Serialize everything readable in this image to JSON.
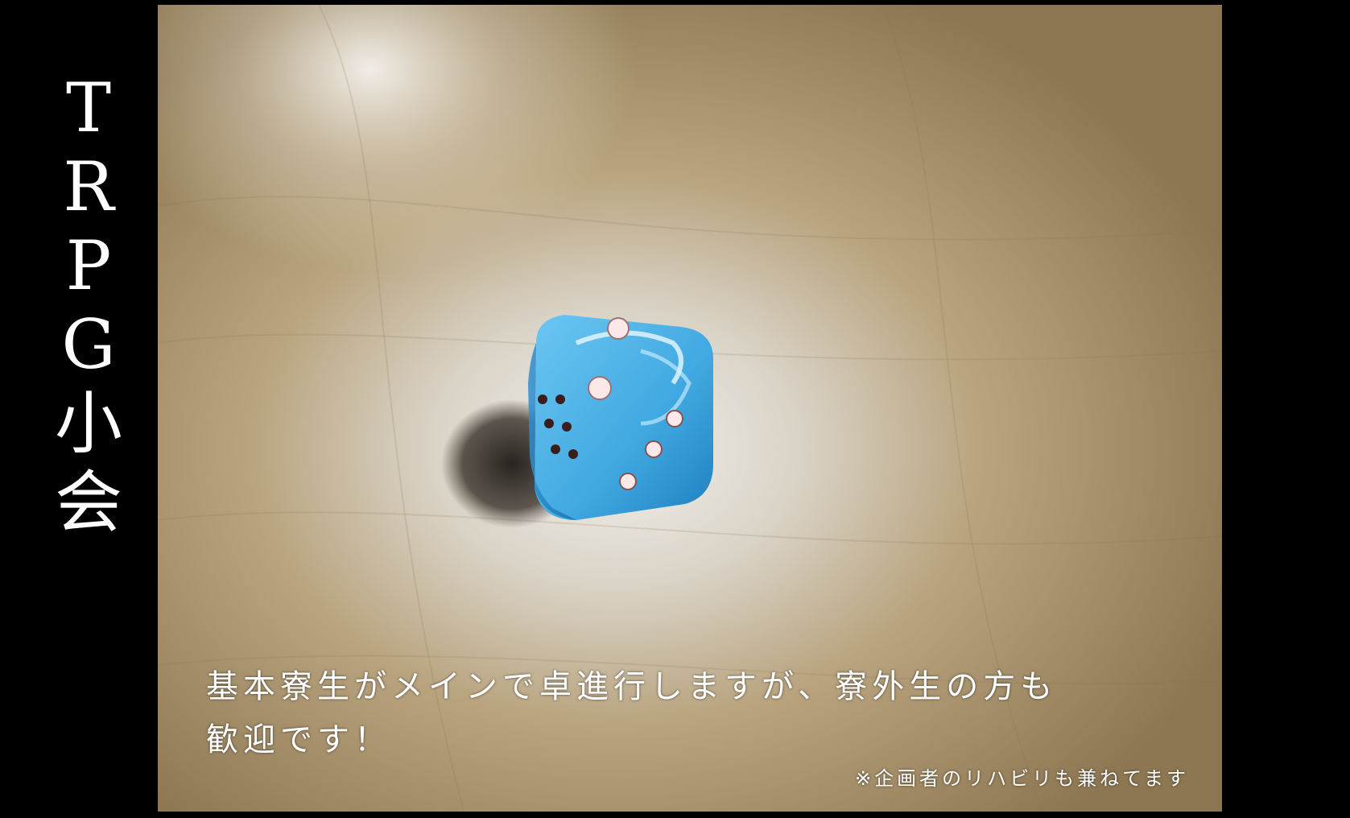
{
  "title_chars": [
    "T",
    "R",
    "P",
    "G",
    "小",
    "会"
  ],
  "photo": {
    "subject": "blue-d6-die-icon",
    "die_color": "#3fa8e0",
    "table_color": "#b39a70"
  },
  "caption": {
    "line1": "基本寮生がメインで卓進行しますが、寮外生の方も",
    "line2": "歓迎です！",
    "note": "※企画者のリハビリも兼ねてます"
  }
}
